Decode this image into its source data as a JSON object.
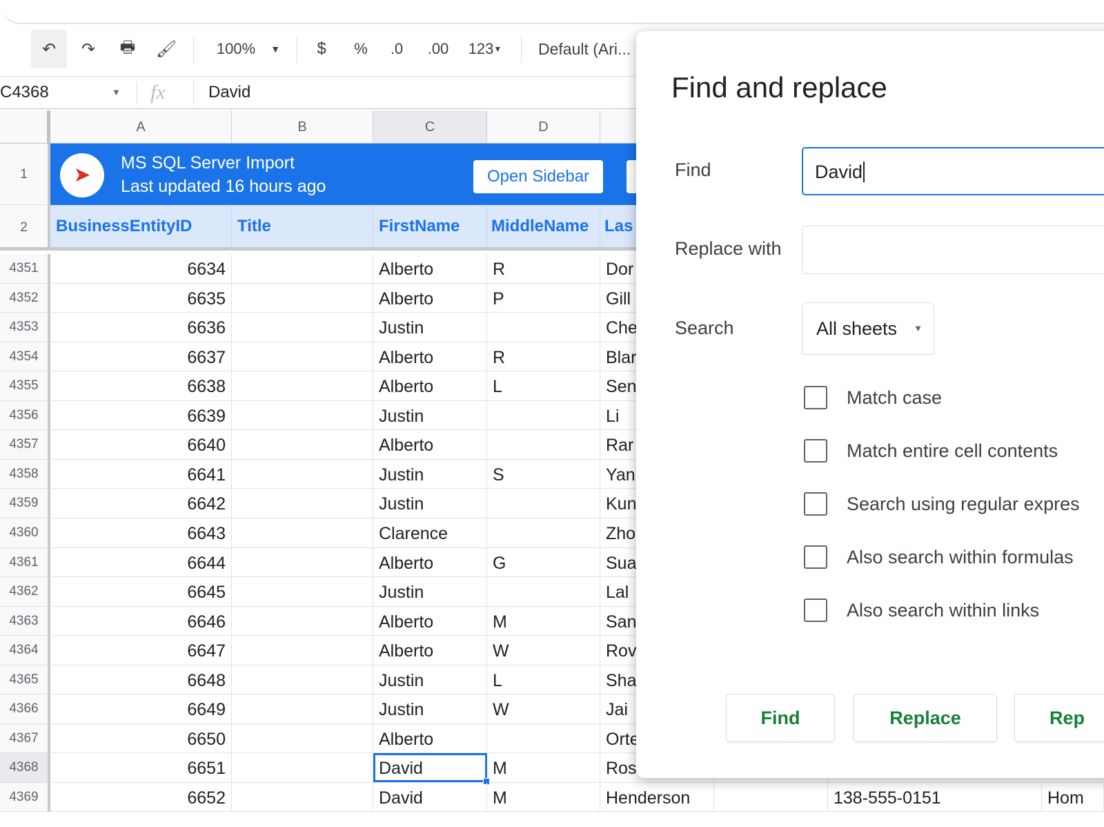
{
  "toolbar": {
    "zoom": "100%",
    "currency": "$",
    "percent": "%",
    "dec_decrease": ".0",
    "dec_increase": ".00",
    "format": "123",
    "font": "Default (Ari..."
  },
  "formula_bar": {
    "cell_ref": "C4368",
    "fx": "fx",
    "value": "David"
  },
  "columns": [
    "A",
    "B",
    "C",
    "D"
  ],
  "banner": {
    "title": "MS SQL Server Import",
    "subtitle": "Last updated 16 hours ago",
    "button": "Open Sidebar"
  },
  "header_row": {
    "num": "1",
    "num2": "2",
    "cells": [
      "BusinessEntityID",
      "Title",
      "FirstName",
      "MiddleName",
      "Las"
    ]
  },
  "rows": [
    {
      "n": "4351",
      "id": "6634",
      "first": "Alberto",
      "mid": "R",
      "last": "Dor"
    },
    {
      "n": "4352",
      "id": "6635",
      "first": "Alberto",
      "mid": "P",
      "last": "Gill"
    },
    {
      "n": "4353",
      "id": "6636",
      "first": "Justin",
      "mid": "",
      "last": "Che"
    },
    {
      "n": "4354",
      "id": "6637",
      "first": "Alberto",
      "mid": "R",
      "last": "Blar"
    },
    {
      "n": "4355",
      "id": "6638",
      "first": "Alberto",
      "mid": "L",
      "last": "Sen"
    },
    {
      "n": "4356",
      "id": "6639",
      "first": "Justin",
      "mid": "",
      "last": "Li"
    },
    {
      "n": "4357",
      "id": "6640",
      "first": "Alberto",
      "mid": "",
      "last": "Rar"
    },
    {
      "n": "4358",
      "id": "6641",
      "first": "Justin",
      "mid": "S",
      "last": "Yan"
    },
    {
      "n": "4359",
      "id": "6642",
      "first": "Justin",
      "mid": "",
      "last": "Kun"
    },
    {
      "n": "4360",
      "id": "6643",
      "first": "Clarence",
      "mid": "",
      "last": "Zho"
    },
    {
      "n": "4361",
      "id": "6644",
      "first": "Alberto",
      "mid": "G",
      "last": "Sua"
    },
    {
      "n": "4362",
      "id": "6645",
      "first": "Justin",
      "mid": "",
      "last": "Lal"
    },
    {
      "n": "4363",
      "id": "6646",
      "first": "Alberto",
      "mid": "M",
      "last": "San"
    },
    {
      "n": "4364",
      "id": "6647",
      "first": "Alberto",
      "mid": "W",
      "last": "Rov"
    },
    {
      "n": "4365",
      "id": "6648",
      "first": "Justin",
      "mid": "L",
      "last": "Sha"
    },
    {
      "n": "4366",
      "id": "6649",
      "first": "Justin",
      "mid": "W",
      "last": "Jai"
    },
    {
      "n": "4367",
      "id": "6650",
      "first": "Alberto",
      "mid": "",
      "last": "Orte"
    },
    {
      "n": "4368",
      "id": "6651",
      "first": "David",
      "mid": "M",
      "last": "Ros"
    },
    {
      "n": "4369",
      "id": "6652",
      "first": "David",
      "mid": "M",
      "last": "Henderson",
      "phone": "138-555-0151",
      "type": "Hom"
    }
  ],
  "dialog": {
    "title": "Find and replace",
    "find_label": "Find",
    "find_value": "David",
    "replace_label": "Replace with",
    "replace_value": "",
    "search_label": "Search",
    "search_value": "All sheets",
    "options": [
      "Match case",
      "Match entire cell contents",
      "Search using regular expres",
      "Also search within formulas",
      "Also search within links"
    ],
    "buttons": [
      "Find",
      "Replace",
      "Rep"
    ]
  },
  "colors": {
    "accent": "#1a73e8",
    "button_text": "#188038"
  }
}
